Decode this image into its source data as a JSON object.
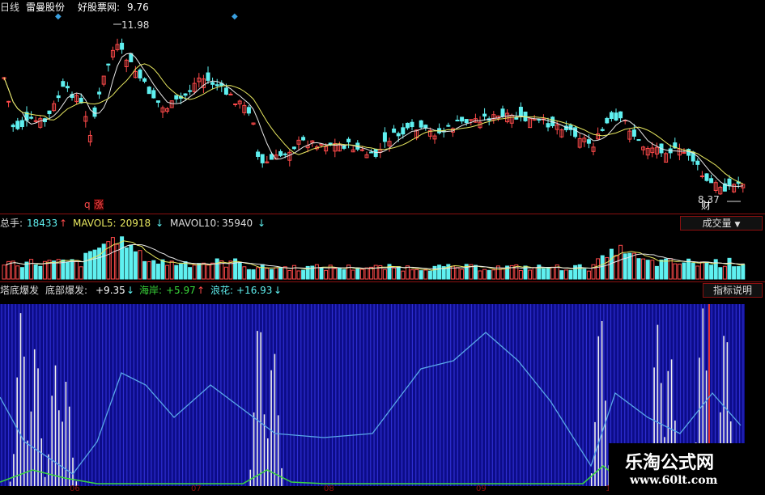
{
  "header": {
    "period": "日线",
    "stock_name": "雷曼股份",
    "site_label": "好股票网:",
    "price": "9.76"
  },
  "price_panel": {
    "high_label": "11.98",
    "low_label": "8.37",
    "marker_q": "q",
    "marker_zhang": "涨",
    "marker_cai": "财"
  },
  "volume_panel": {
    "total_label": "总手:",
    "total_value": "18433",
    "mavol5_label": "MAVOL5:",
    "mavol5_value": "20918",
    "mavol10_label": "MAVOL10:",
    "mavol10_value": "35940",
    "dropdown_label": "成交量",
    "dropdown_icon": "triangle-down"
  },
  "indicator_panel": {
    "name": "塔底爆发",
    "bottom_label": "底部爆发:",
    "bottom_value": "+9.35",
    "haian_label": "海岸:",
    "haian_value": "+5.97",
    "langhua_label": "浪花:",
    "langhua_value": "+16.93",
    "help_button": "指标说明"
  },
  "date_axis": [
    "06",
    "07",
    "08",
    "09",
    "10"
  ],
  "watermark": {
    "title": "乐淘公式网",
    "url": "www.60lt.com"
  },
  "colors": {
    "up": "#ff4a4a",
    "down": "#5ff0f0",
    "panel_blue": "#0c0c88",
    "separator": "#8a1010",
    "ma_yellow": "#e8e860",
    "haian_green": "#3ad83a"
  }
}
